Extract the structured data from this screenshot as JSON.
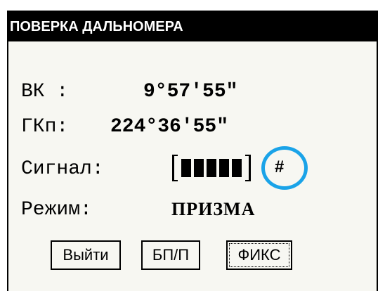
{
  "window": {
    "title": "ПОВЕРКА ДАЛЬНОМЕРА"
  },
  "fields": {
    "vk_label": "ВК :",
    "vk_value": "9°57'55\"",
    "gkp_label": "ГКп:",
    "gkp_value": "224°36'55\"",
    "signal_label": "Сигнал:",
    "signal_level_bars": 5,
    "signal_max_bars": 5,
    "signal_symbol": "#",
    "mode_label": "Режим:",
    "mode_value": "ПРИЗМА"
  },
  "buttons": {
    "exit_label": "Выйти",
    "bpp_label": "БП/П",
    "fix_label": "ФИКС"
  },
  "colors": {
    "highlight_ring": "#1aa3e8",
    "titlebar_bg": "#000000",
    "screen_bg": "#f7f7f2"
  },
  "icons": {
    "signal_meter": "signal-strength-meter"
  }
}
